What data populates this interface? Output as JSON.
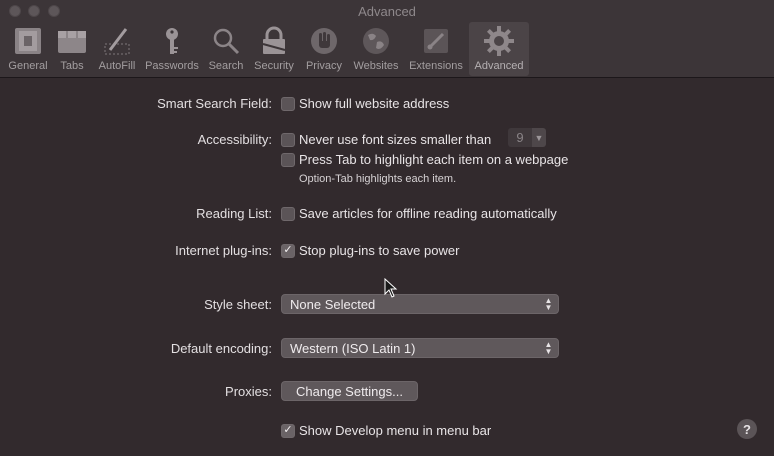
{
  "window": {
    "title": "Advanced"
  },
  "toolbar": {
    "items": [
      {
        "label": "General",
        "icon": "general-switch-icon"
      },
      {
        "label": "Tabs",
        "icon": "tabs-icon"
      },
      {
        "label": "AutoFill",
        "icon": "autofill-pen-icon"
      },
      {
        "label": "Passwords",
        "icon": "key-icon"
      },
      {
        "label": "Search",
        "icon": "search-icon"
      },
      {
        "label": "Security",
        "icon": "lock-icon"
      },
      {
        "label": "Privacy",
        "icon": "hand-icon"
      },
      {
        "label": "Websites",
        "icon": "globe-icon"
      },
      {
        "label": "Extensions",
        "icon": "puzzle-icon"
      },
      {
        "label": "Advanced",
        "icon": "gear-icon",
        "selected": true
      }
    ]
  },
  "settings": {
    "smart_search_label": "Smart Search Field:",
    "smart_search_option": "Show full website address",
    "smart_search_checked": false,
    "accessibility_label": "Accessibility:",
    "font_size_option": "Never use font sizes smaller than",
    "font_size_checked": false,
    "font_size_value": "9",
    "tab_highlight_option": "Press Tab to highlight each item on a webpage",
    "tab_highlight_checked": false,
    "tab_hint": "Option-Tab highlights each item.",
    "reading_list_label": "Reading List:",
    "reading_list_option": "Save articles for offline reading automatically",
    "reading_list_checked": false,
    "plugins_label": "Internet plug-ins:",
    "plugins_option": "Stop plug-ins to save power",
    "plugins_checked": true,
    "stylesheet_label": "Style sheet:",
    "stylesheet_value": "None Selected",
    "encoding_label": "Default encoding:",
    "encoding_value": "Western (ISO Latin 1)",
    "proxies_label": "Proxies:",
    "proxies_button": "Change Settings...",
    "develop_option": "Show Develop menu in menu bar",
    "develop_checked": true
  },
  "help": {
    "label": "?"
  },
  "colors": {
    "background": "#322a2d",
    "toolbar": "#3c3538",
    "control": "#5f585b"
  }
}
